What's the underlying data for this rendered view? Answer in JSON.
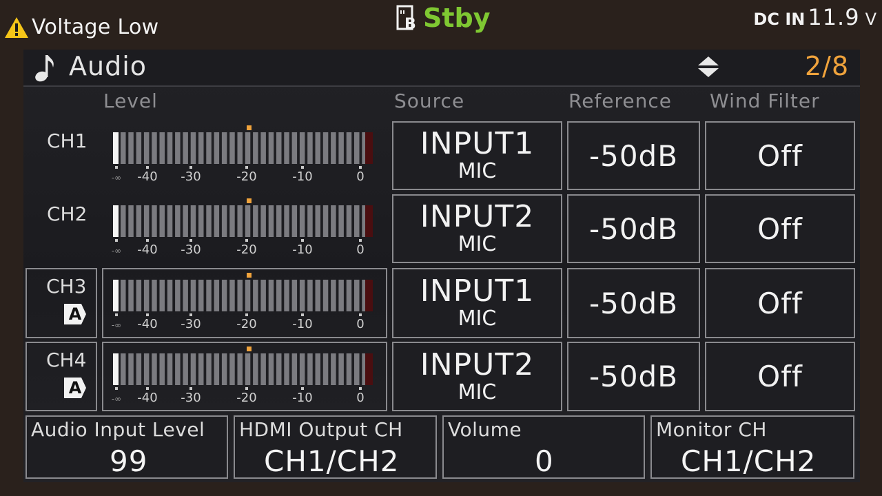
{
  "status": {
    "warning": "Voltage Low",
    "record_state": "Stby",
    "power_label": "DC IN",
    "power_value": "11.9",
    "power_unit": "V"
  },
  "header": {
    "title": "Audio",
    "page": "2/8"
  },
  "columns": {
    "level": "Level",
    "source": "Source",
    "reference": "Reference",
    "wind_filter": "Wind Filter"
  },
  "meter_scale": [
    "-∞",
    "-40",
    "-30",
    "-20",
    "-10",
    "0"
  ],
  "channels": [
    {
      "label": "CH1",
      "auto": false,
      "badge": "",
      "source_main": "INPUT1",
      "source_sub": "MIC",
      "reference": "-50dB",
      "wind_filter": "Off"
    },
    {
      "label": "CH2",
      "auto": false,
      "badge": "",
      "source_main": "INPUT2",
      "source_sub": "MIC",
      "reference": "-50dB",
      "wind_filter": "Off"
    },
    {
      "label": "CH3",
      "auto": true,
      "badge": "A",
      "source_main": "INPUT1",
      "source_sub": "MIC",
      "reference": "-50dB",
      "wind_filter": "Off"
    },
    {
      "label": "CH4",
      "auto": true,
      "badge": "A",
      "source_main": "INPUT2",
      "source_sub": "MIC",
      "reference": "-50dB",
      "wind_filter": "Off"
    }
  ],
  "bottom": {
    "audio_input_level_label": "Audio Input Level",
    "audio_input_level_value": "99",
    "hdmi_output_label": "HDMI Output CH",
    "hdmi_output_value": "CH1/CH2",
    "volume_label": "Volume",
    "volume_value": "0",
    "monitor_label": "Monitor CH",
    "monitor_value": "CH1/CH2"
  },
  "colors": {
    "accent_orange": "#f0a33c",
    "standby_green": "#7fc832",
    "warning_yellow": "#f5c518"
  },
  "icons": [
    "warning-icon",
    "media-card-icon",
    "music-note-icon",
    "up-down-arrows-icon"
  ]
}
